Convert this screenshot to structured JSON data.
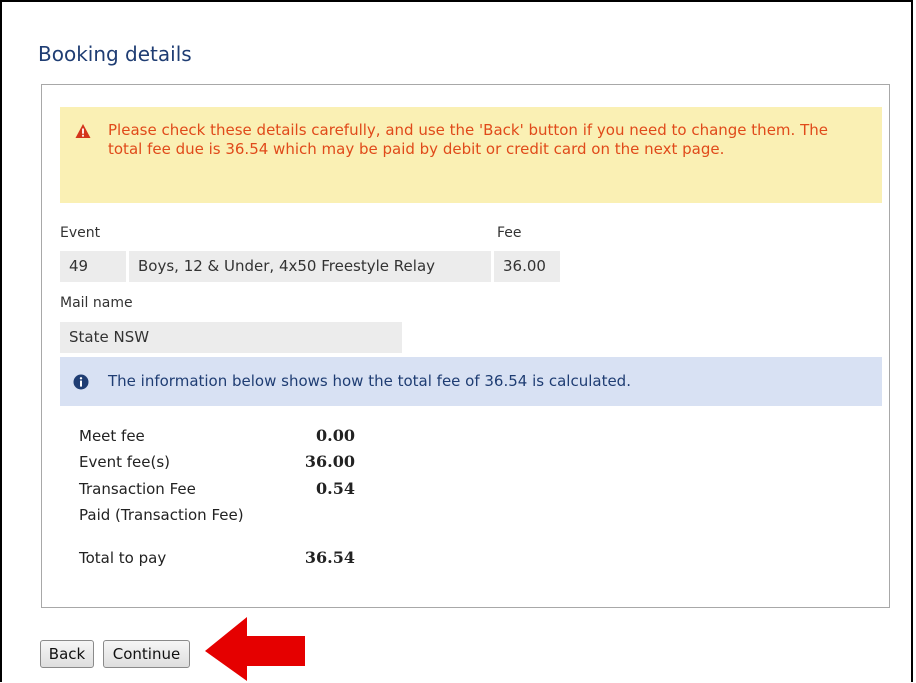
{
  "heading": "Booking details",
  "warning": {
    "text": "Please check these details carefully, and use the 'Back' button if you need to change them. The total fee due is 36.54 which may be paid by debit or credit card on the next page.",
    "icon": "warning-triangle-icon",
    "color": "#e04a1a",
    "background": "#faf0b4"
  },
  "event": {
    "event_label": "Event",
    "fee_label": "Fee",
    "number": "49",
    "description": "Boys, 12 & Under, 4x50 Freestyle Relay",
    "fee": "36.00"
  },
  "mail": {
    "label": "Mail name",
    "value": "State NSW"
  },
  "info": {
    "text": "The information below shows how the total fee of 36.54 is calculated.",
    "icon": "info-circle-icon",
    "background": "#d8e1f3"
  },
  "fees": {
    "meet_fee_label": "Meet fee",
    "meet_fee_value": "0.00",
    "event_fees_label": "Event fee(s)",
    "event_fees_value": "36.00",
    "transaction_fee_label": "Transaction Fee",
    "transaction_fee_value": "0.54",
    "paid_label": "Paid (Transaction Fee)",
    "total_label": "Total to pay",
    "total_value": "36.54"
  },
  "buttons": {
    "back": "Back",
    "continue": "Continue"
  },
  "accent_arrow_color": "#e50000"
}
